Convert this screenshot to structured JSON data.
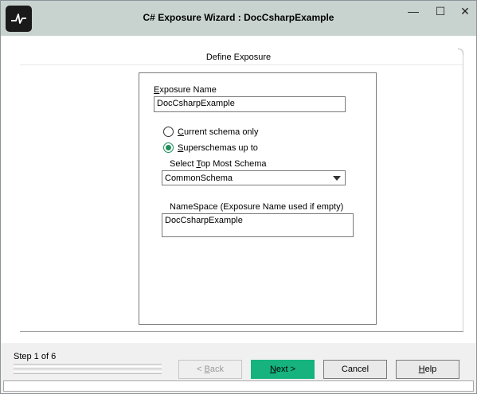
{
  "window": {
    "title": "C# Exposure Wizard : DocCsharpExample",
    "minimize_glyph": "—",
    "maximize_glyph": "☐",
    "close_glyph": "✕"
  },
  "page": {
    "section_title": "Define Exposure",
    "exposure_name": {
      "label_accel": "E",
      "label_rest": "xposure Name",
      "value": "DocCsharpExample"
    },
    "schema_option": {
      "current": {
        "label_accel": "C",
        "label_rest": "urrent schema only",
        "checked": false
      },
      "super": {
        "label_accel": "S",
        "label_rest": "uperschemas up to",
        "checked": true
      }
    },
    "top_schema": {
      "label_pre": "Select ",
      "label_accel": "T",
      "label_rest": "op Most Schema",
      "value": "CommonSchema"
    },
    "namespace": {
      "label": "NameSpace (Exposure Name used if empty)",
      "value": "DocCsharpExample"
    }
  },
  "footer": {
    "step": "Step 1 of 6",
    "back_pre": "< ",
    "back_accel": "B",
    "back_rest": "ack",
    "next_accel": "N",
    "next_rest": "ext >",
    "cancel": "Cancel",
    "help_accel": "H",
    "help_rest": "elp"
  },
  "colors": {
    "titlebar": "#c8d3cf",
    "accent": "#16b37e"
  },
  "icons": [
    "app-logo-icon",
    "minimize-icon",
    "maximize-icon",
    "close-icon",
    "chevron-down-icon"
  ]
}
